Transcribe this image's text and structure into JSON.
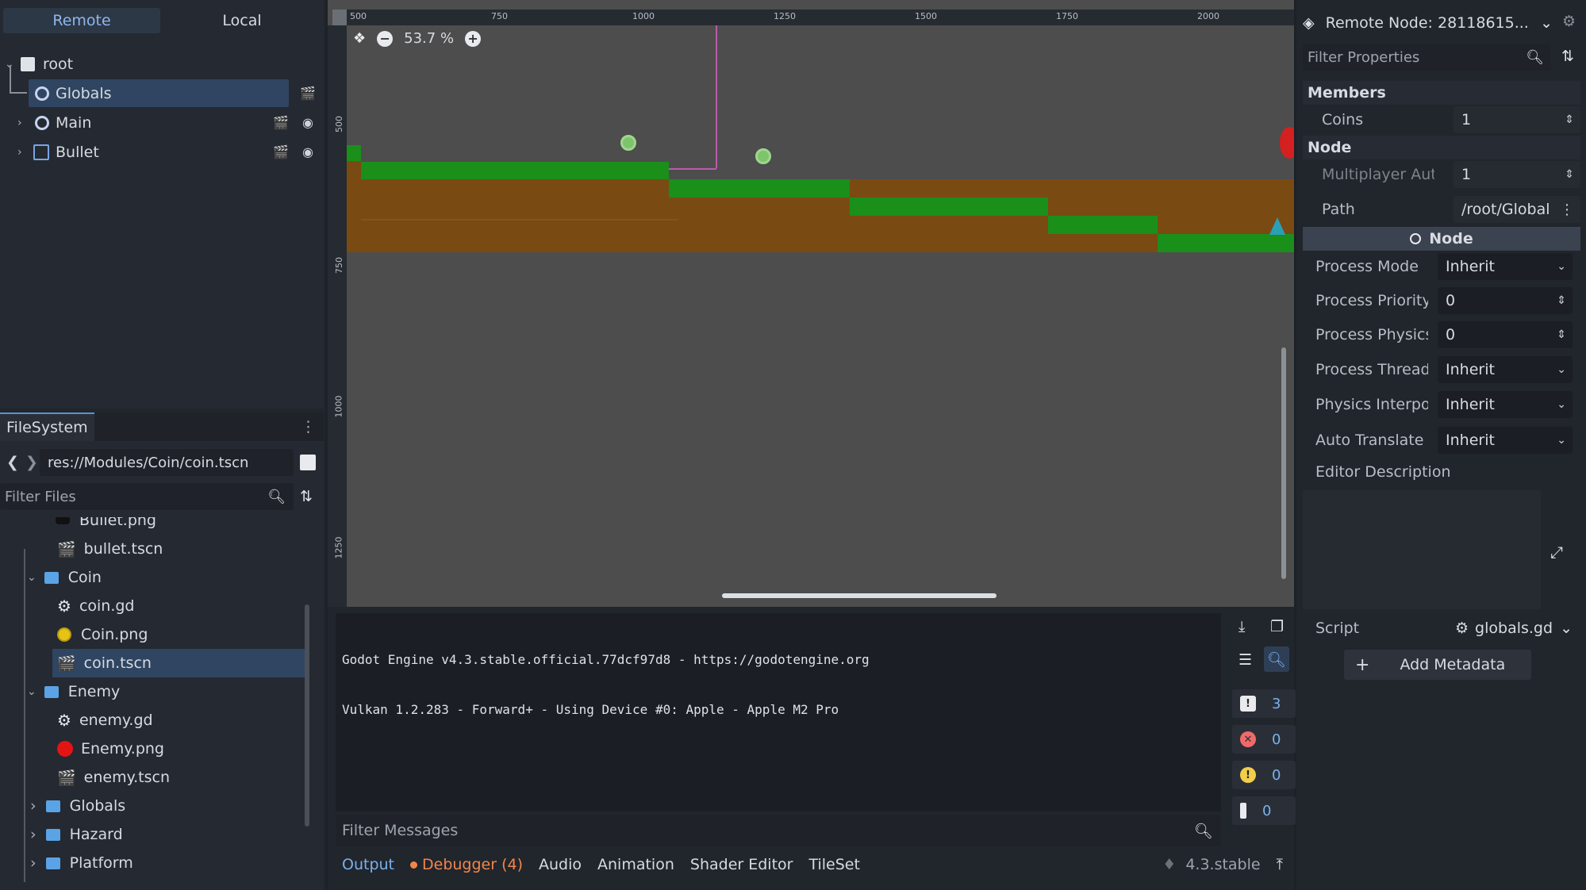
{
  "scene_dock": {
    "tabs": [
      "Remote",
      "Local"
    ],
    "tree": [
      {
        "label": "root"
      },
      {
        "label": "Globals"
      },
      {
        "label": "Main"
      },
      {
        "label": "Bullet"
      }
    ]
  },
  "filesystem": {
    "tab": "FileSystem",
    "path": "res://Modules/Coin/coin.tscn",
    "filter_placeholder": "Filter Files",
    "items": [
      {
        "label": "Bullet.png"
      },
      {
        "label": "bullet.tscn"
      },
      {
        "label": "Coin"
      },
      {
        "label": "coin.gd"
      },
      {
        "label": "Coin.png"
      },
      {
        "label": "coin.tscn"
      },
      {
        "label": "Enemy"
      },
      {
        "label": "enemy.gd"
      },
      {
        "label": "Enemy.png"
      },
      {
        "label": "enemy.tscn"
      },
      {
        "label": "Globals"
      },
      {
        "label": "Hazard"
      },
      {
        "label": "Platform"
      }
    ]
  },
  "viewport": {
    "zoom": "53.7 %",
    "ruler_top": [
      "500",
      "750",
      "1000",
      "1250",
      "1500",
      "1750",
      "2000"
    ],
    "ruler_left": [
      "500",
      "750",
      "1000",
      "1250"
    ]
  },
  "output": {
    "lines": [
      "Godot Engine v4.3.stable.official.77dcf97d8 - https://godotengine.org",
      "Vulkan 1.2.283 - Forward+ - Using Device #0: Apple - Apple M2 Pro"
    ],
    "filter_placeholder": "Filter Messages",
    "counts": {
      "messages": "3",
      "errors": "0",
      "warnings": "0",
      "info": "0"
    }
  },
  "bottom_tabs": {
    "output": "Output",
    "debugger": "Debugger (4)",
    "audio": "Audio",
    "animation": "Animation",
    "shader_editor": "Shader Editor",
    "tileset": "TileSet",
    "version": "4.3.stable"
  },
  "inspector": {
    "title": "Remote Node: 28118615...",
    "filter_placeholder": "Filter Properties",
    "sections": {
      "members": "Members",
      "node": "Node",
      "node_header": "Node"
    },
    "props": {
      "coins": {
        "name": "Coins",
        "value": "1"
      },
      "multiplayer": {
        "name": "Multiplayer Aut",
        "value": "1"
      },
      "path": {
        "name": "Path",
        "value": "/root/Global"
      },
      "process_mode": {
        "name": "Process Mode",
        "value": "Inherit"
      },
      "process_priority": {
        "name": "Process Priority",
        "value": "0"
      },
      "process_physics": {
        "name": "Process Physics P",
        "value": "0"
      },
      "process_thread": {
        "name": "Process Thread G",
        "value": "Inherit"
      },
      "physics_interp": {
        "name": "Physics Interpola",
        "value": "Inherit"
      },
      "auto_translate": {
        "name": "Auto Translate M",
        "value": "Inherit"
      },
      "editor_desc": {
        "name": "Editor Description"
      },
      "script": {
        "name": "Script",
        "value": "globals.gd"
      }
    },
    "add_metadata": "Add Metadata"
  },
  "colors": {
    "accent": "#5793d6",
    "grass": "#1a8f1a",
    "dirt": "#7a4a13",
    "selection": "#2f4561"
  }
}
